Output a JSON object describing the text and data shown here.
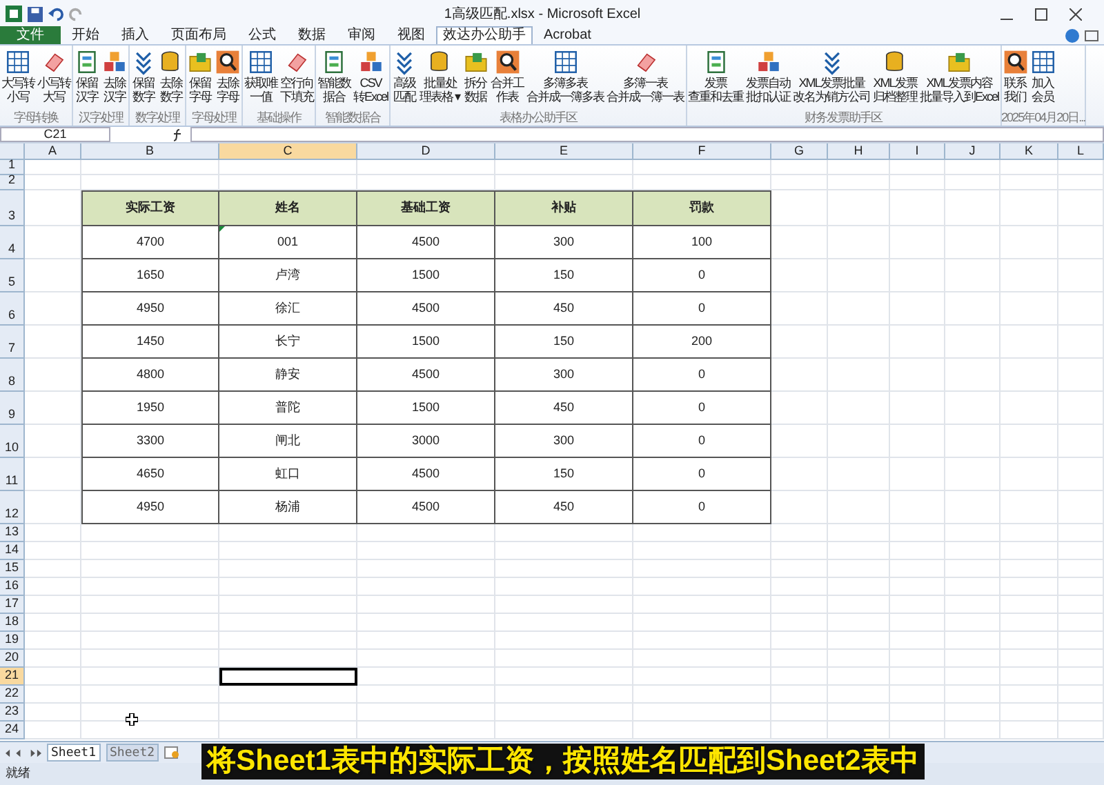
{
  "window": {
    "title": "1高级匹配.xlsx - Microsoft Excel"
  },
  "tabs": [
    {
      "label": "文件",
      "kind": "file",
      "selected": false
    },
    {
      "label": "开始",
      "kind": "tab",
      "selected": false
    },
    {
      "label": "插入",
      "kind": "tab",
      "selected": false
    },
    {
      "label": "页面布局",
      "kind": "tab",
      "selected": false
    },
    {
      "label": "公式",
      "kind": "tab",
      "selected": false
    },
    {
      "label": "数据",
      "kind": "tab",
      "selected": false
    },
    {
      "label": "审阅",
      "kind": "tab",
      "selected": false
    },
    {
      "label": "视图",
      "kind": "tab",
      "selected": false
    },
    {
      "label": "效达办公助手",
      "kind": "tab",
      "selected": true
    },
    {
      "label": "Acrobat",
      "kind": "tab",
      "selected": false
    }
  ],
  "ribbon": {
    "groups": [
      {
        "label": "字母转换",
        "buttons": [
          {
            "lines": [
              "大写转",
              "小写"
            ]
          },
          {
            "lines": [
              "小写转",
              "大写"
            ]
          }
        ]
      },
      {
        "label": "汉字处理",
        "buttons": [
          {
            "lines": [
              "保留",
              "汉字"
            ]
          },
          {
            "lines": [
              "去除",
              "汉字"
            ]
          }
        ]
      },
      {
        "label": "数字处理",
        "buttons": [
          {
            "lines": [
              "保留",
              "数字"
            ]
          },
          {
            "lines": [
              "去除",
              "数字"
            ]
          }
        ]
      },
      {
        "label": "字母处理",
        "buttons": [
          {
            "lines": [
              "保留",
              "字母"
            ]
          },
          {
            "lines": [
              "去除",
              "字母"
            ]
          }
        ]
      },
      {
        "label": "基础操作",
        "buttons": [
          {
            "lines": [
              "获取唯",
              "一值"
            ]
          },
          {
            "lines": [
              "空行向",
              "下填充"
            ]
          }
        ]
      },
      {
        "label": "智能数据合",
        "buttons": [
          {
            "lines": [
              "智能数",
              "据合"
            ]
          },
          {
            "lines": [
              "CSV",
              "转Excel"
            ]
          }
        ]
      },
      {
        "label": "表格办公助手区",
        "buttons": [
          {
            "lines": [
              "高级",
              "匹配"
            ]
          },
          {
            "lines": [
              "批量处",
              "理表格 ▾"
            ]
          },
          {
            "lines": [
              "拆分",
              "数据"
            ]
          },
          {
            "lines": [
              "合并工",
              "作表"
            ]
          },
          {
            "lines": [
              "多簿多表",
              "合并成一簿多表"
            ]
          },
          {
            "lines": [
              "多簿一表",
              "合并成一簿一表"
            ]
          }
        ]
      },
      {
        "label": "财务发票助手区",
        "buttons": [
          {
            "lines": [
              "发票",
              "查重和去重"
            ]
          },
          {
            "lines": [
              "发票自动",
              "批扣认证"
            ]
          },
          {
            "lines": [
              "XML发票批量",
              "改名为销方公司"
            ]
          },
          {
            "lines": [
              "XML发票",
              "归档整理"
            ]
          },
          {
            "lines": [
              "XML发票内容",
              "批量导入到Excel"
            ]
          }
        ]
      },
      {
        "label": "2025年04月20日...",
        "buttons": [
          {
            "lines": [
              "联系",
              "我们"
            ]
          },
          {
            "lines": [
              "加入",
              "会员"
            ]
          }
        ]
      }
    ]
  },
  "formula_bar": {
    "name_box": "C21"
  },
  "columns": [
    {
      "label": "A",
      "selected": false
    },
    {
      "label": "B",
      "selected": false
    },
    {
      "label": "C",
      "selected": true
    },
    {
      "label": "D",
      "selected": false
    },
    {
      "label": "E",
      "selected": false
    },
    {
      "label": "F",
      "selected": false
    },
    {
      "label": "G",
      "selected": false
    },
    {
      "label": "H",
      "selected": false
    },
    {
      "label": "I",
      "selected": false
    },
    {
      "label": "J",
      "selected": false
    },
    {
      "label": "K",
      "selected": false
    },
    {
      "label": "L",
      "selected": false
    }
  ],
  "rows": [
    {
      "label": "1",
      "selected": false
    },
    {
      "label": "2",
      "selected": false
    },
    {
      "label": "3",
      "selected": false
    },
    {
      "label": "4",
      "selected": false
    },
    {
      "label": "5",
      "selected": false
    },
    {
      "label": "6",
      "selected": false
    },
    {
      "label": "7",
      "selected": false
    },
    {
      "label": "8",
      "selected": false
    },
    {
      "label": "9",
      "selected": false
    },
    {
      "label": "10",
      "selected": false
    },
    {
      "label": "11",
      "selected": false
    },
    {
      "label": "12",
      "selected": false
    },
    {
      "label": "13",
      "selected": false
    },
    {
      "label": "14",
      "selected": false
    },
    {
      "label": "15",
      "selected": false
    },
    {
      "label": "16",
      "selected": false
    },
    {
      "label": "17",
      "selected": false
    },
    {
      "label": "18",
      "selected": false
    },
    {
      "label": "19",
      "selected": false
    },
    {
      "label": "20",
      "selected": false
    },
    {
      "label": "21",
      "selected": true
    },
    {
      "label": "22",
      "selected": false
    },
    {
      "label": "23",
      "selected": false
    },
    {
      "label": "24",
      "selected": false
    }
  ],
  "table": {
    "columns": [
      "实际工资",
      "姓名",
      "基础工资",
      "补贴",
      "罚款"
    ],
    "rows": [
      {
        "cells": [
          "4700",
          "001",
          "4500",
          "300",
          "100"
        ],
        "flagged": true
      },
      {
        "cells": [
          "1650",
          "卢湾",
          "1500",
          "150",
          "0"
        ],
        "flagged": false
      },
      {
        "cells": [
          "4950",
          "徐汇",
          "4500",
          "450",
          "0"
        ],
        "flagged": false
      },
      {
        "cells": [
          "1450",
          "长宁",
          "1500",
          "150",
          "200"
        ],
        "flagged": false
      },
      {
        "cells": [
          "4800",
          "静安",
          "4500",
          "300",
          "0"
        ],
        "flagged": false
      },
      {
        "cells": [
          "1950",
          "普陀",
          "1500",
          "450",
          "0"
        ],
        "flagged": false
      },
      {
        "cells": [
          "3300",
          "闸北",
          "3000",
          "300",
          "0"
        ],
        "flagged": false
      },
      {
        "cells": [
          "4650",
          "虹口",
          "4500",
          "150",
          "0"
        ],
        "flagged": false
      },
      {
        "cells": [
          "4950",
          "杨浦",
          "4500",
          "450",
          "0"
        ],
        "flagged": false
      }
    ]
  },
  "sheet_tabs": [
    {
      "label": "Sheet1",
      "selected": true
    },
    {
      "label": "Sheet2",
      "selected": false
    }
  ],
  "status_bar": {
    "text": "就绪"
  },
  "caption": "将Sheet1表中的实际工资，按照姓名匹配到Sheet2表中"
}
